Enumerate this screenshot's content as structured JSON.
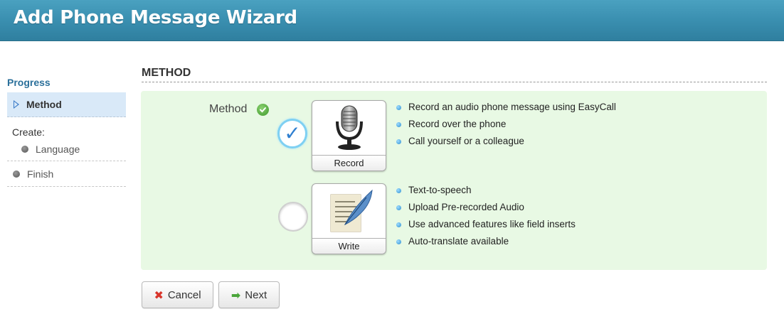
{
  "window": {
    "title": "Add Phone Message Wizard"
  },
  "sidebar": {
    "progress_title": "Progress",
    "active_step": "Method",
    "create_label": "Create:",
    "sub_steps": [
      "Language"
    ],
    "finish_step": "Finish"
  },
  "main": {
    "section_title": "METHOD",
    "method_label": "Method",
    "options": [
      {
        "label": "Record",
        "selected": true,
        "icon": "microphone-icon",
        "features": [
          "Record an audio phone message using EasyCall",
          "Record over the phone",
          "Call yourself or a colleague"
        ]
      },
      {
        "label": "Write",
        "selected": false,
        "icon": "quill-document-icon",
        "features": [
          "Text-to-speech",
          "Upload Pre-recorded Audio",
          "Use advanced features like field inserts",
          "Auto-translate available"
        ]
      }
    ]
  },
  "buttons": {
    "cancel": "Cancel",
    "next": "Next"
  },
  "colors": {
    "header": "#3a8fb0",
    "panel_bg": "#e8f9e4",
    "active_step_bg": "#d9e9f8",
    "selected_ring": "#7fd0f2"
  }
}
